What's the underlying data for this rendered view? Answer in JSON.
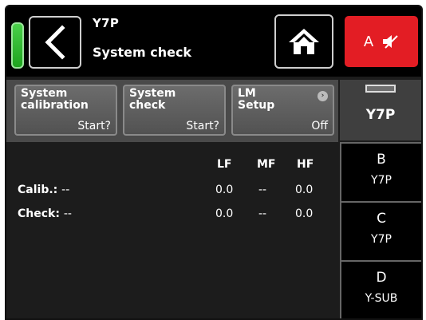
{
  "header": {
    "device_name": "Y7P",
    "page_title": "System check",
    "mute_channel": "A"
  },
  "toolbar": [
    {
      "label": "System\ncalibration",
      "value": "Start?"
    },
    {
      "label": "System\ncheck",
      "value": "Start?"
    },
    {
      "label": "LM\nSetup",
      "value": "Off"
    }
  ],
  "table": {
    "columns": [
      "LF",
      "MF",
      "HF"
    ],
    "rows": [
      {
        "label": "Calib.:",
        "status": "--",
        "values": [
          "0.0",
          "--",
          "0.0"
        ]
      },
      {
        "label": "Check:",
        "status": "--",
        "values": [
          "0.0",
          "--",
          "0.0"
        ]
      }
    ]
  },
  "channels": [
    {
      "letter": "",
      "type": "Y7P"
    },
    {
      "letter": "B",
      "type": "Y7P"
    },
    {
      "letter": "C",
      "type": "Y7P"
    },
    {
      "letter": "D",
      "type": "Y-SUB"
    }
  ],
  "colors": {
    "led": "#2cc02c",
    "mute": "#e31d24",
    "panel": "#4a4a4a"
  },
  "icons": {
    "back": "chevron-left-icon",
    "home": "home-icon",
    "mute": "speaker-muted-icon",
    "info": "chevron-right-icon"
  }
}
